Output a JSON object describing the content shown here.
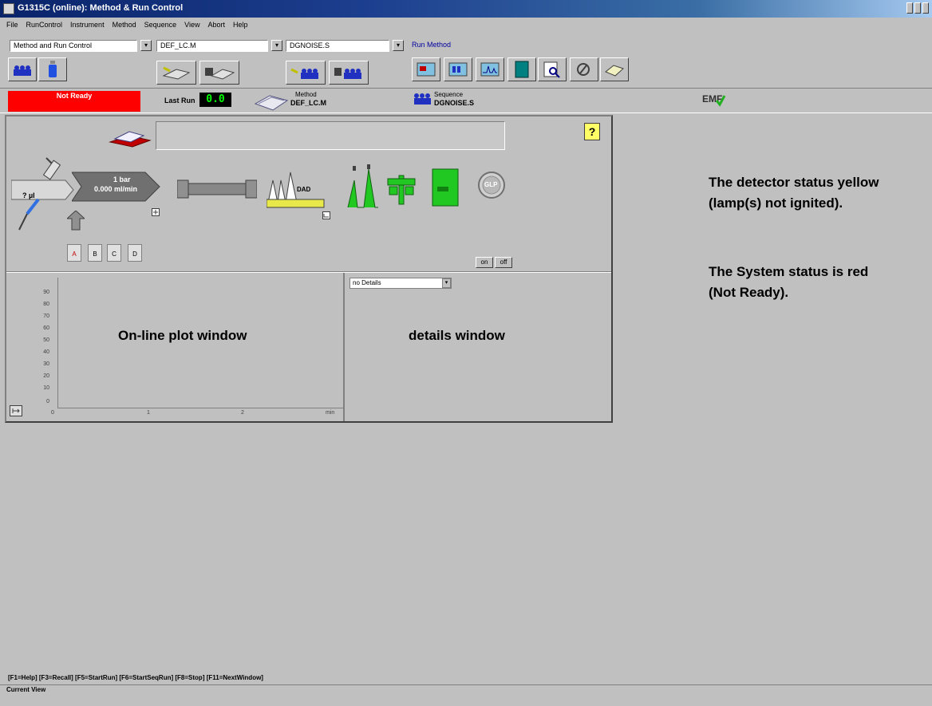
{
  "window": {
    "title": "G1315C (online): Method & Run Control",
    "controls": [
      "minimize-icon",
      "maximize-icon",
      "close-icon"
    ]
  },
  "menu": [
    "File",
    "RunControl",
    "Instrument",
    "Method",
    "Sequence",
    "View",
    "Abort",
    "Help"
  ],
  "toolbar": {
    "view_select": "Method and Run Control",
    "method_select": "DEF_LC.M",
    "sequence_select": "DGNOISE.S",
    "run_method_label": "Run Method"
  },
  "status": {
    "system_status": "Not Ready",
    "last_run_label": "Last Run",
    "last_run_value": "0.0",
    "method_label": "Method",
    "method_value": "DEF_LC.M",
    "sequence_label": "Sequence",
    "sequence_value": "DGNOISE.S",
    "emf_label": "EMF"
  },
  "instrument": {
    "injector_volume": "? µl",
    "pump_pressure": "1 bar",
    "pump_flow": "0.000 ml/min",
    "detector_label": "DAD",
    "glp_label": "GLP",
    "bottles": [
      "A",
      "B",
      "C",
      "D"
    ],
    "on_label": "on",
    "off_label": "off",
    "help_label": "?"
  },
  "plot": {
    "y_ticks": [
      "90",
      "80",
      "70",
      "60",
      "50",
      "40",
      "30",
      "20",
      "10",
      "0"
    ],
    "x_ticks": [
      "0",
      "1",
      "2",
      "min"
    ],
    "overlay_label": "On-line plot window"
  },
  "details": {
    "selected": "no Details",
    "overlay_label": "details window"
  },
  "annotations": {
    "detector": "The detector status yellow (lamp(s) not ignited).",
    "system": "The System status is red (Not Ready)."
  },
  "footer": {
    "fkeys": "[F1=Help] [F3=Recall] [F5=StartRun] [F6=StartSeqRun] [F8=Stop] [F11=NextWindow]",
    "current_view": "Current View"
  },
  "colors": {
    "not_ready": "#ff0000",
    "detector_yellow": "#e8e84a",
    "peaks_green": "#22c822",
    "title_bar": "#0a246a"
  }
}
